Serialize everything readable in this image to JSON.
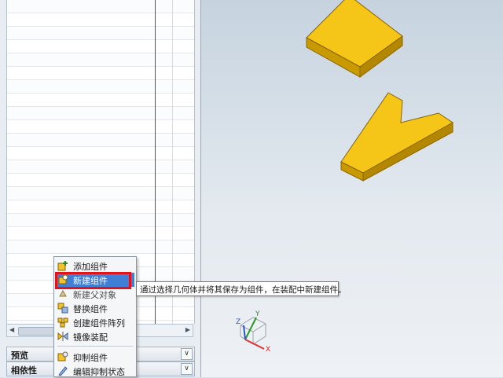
{
  "navigator": {
    "sections": [
      {
        "label": "预览",
        "expand_icon": "chevron-down-icon"
      },
      {
        "label": "相依性",
        "expand_icon": "chevron-down-icon"
      }
    ],
    "scroll_left_icon": "arrow-left-icon",
    "scroll_right_icon": "arrow-right-icon"
  },
  "context_menu": {
    "items": [
      {
        "label": "添加组件",
        "icon": "add-component-icon"
      },
      {
        "label": "新建组件",
        "icon": "new-component-icon",
        "selected": true
      },
      {
        "label": "新建父对象",
        "icon": "new-parent-icon"
      },
      {
        "label": "替换组件",
        "icon": "replace-component-icon"
      },
      {
        "label": "创建组件阵列",
        "icon": "component-array-icon"
      },
      {
        "label": "镜像装配",
        "icon": "mirror-assembly-icon"
      },
      {
        "label": "抑制组件",
        "icon": "suppress-component-icon"
      },
      {
        "label": "编辑抑制状态",
        "icon": "edit-suppression-icon"
      }
    ]
  },
  "tooltip": {
    "text": "通过选择几何体并将其保存为组件，在装配中新建组件。"
  },
  "triad": {
    "x": "X",
    "y": "Y",
    "z": "Z"
  },
  "colors": {
    "part_fill": "#f5c518",
    "part_edge": "#8a6400",
    "highlight": "#e0141d",
    "selection": "#3f7fd6"
  }
}
